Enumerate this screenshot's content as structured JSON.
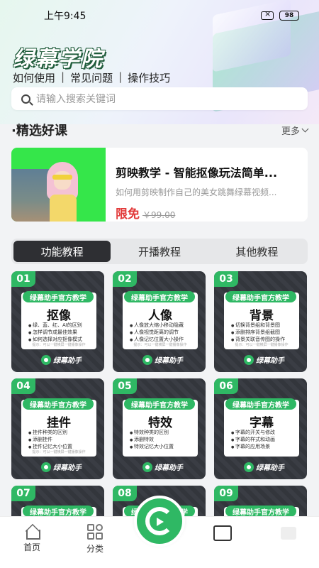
{
  "status_bar": {
    "time": "上午9:45",
    "battery": "98"
  },
  "hero": {
    "brand": "绿幕学院",
    "subnav": [
      "如何使用",
      "常见问题",
      "操作技巧"
    ],
    "subnav_separator": "|"
  },
  "search": {
    "placeholder": "请输入搜索关键词"
  },
  "featured": {
    "title": "·精选好课",
    "more_label": "更多",
    "course": {
      "title": "剪映教学 - 智能抠像玩法简单...",
      "description": "如何用剪映制作自己的美女跳舞绿幕视频...",
      "price_label": "限免",
      "original_price": "￥99.00"
    }
  },
  "tabs": [
    {
      "label": "功能教程",
      "active": true
    },
    {
      "label": "开播教程",
      "active": false
    },
    {
      "label": "其他教程",
      "active": false
    }
  ],
  "cards": [
    {
      "number": "01",
      "tag": "绿幕助手官方教学",
      "title": "抠像",
      "points": [
        "绿、蓝、红、AI的区别",
        "怎样调节成最佳效果",
        "如何选择对应抠像模式"
      ],
      "tip": "提示：可以一键横屏一键播像操作",
      "logo": "绿幕助手"
    },
    {
      "number": "02",
      "tag": "绿幕助手官方教学",
      "title": "人像",
      "points": [
        "人像放大缩小移动隐藏",
        "人像视觉距离的调节",
        "人像记忆位置大小操作"
      ],
      "tip": "提示：可以一键横屏一键播像操作",
      "logo": "绿幕助手"
    },
    {
      "number": "03",
      "tag": "绿幕助手官方教学",
      "title": "背景",
      "points": [
        "切换背景组和背景图",
        "添删排序背景组截图",
        "背景关联音传图的操作"
      ],
      "tip": "提示：可以一键横屏一键播像操作",
      "logo": "绿幕助手"
    },
    {
      "number": "04",
      "tag": "绿幕助手官方教学",
      "title": "挂件",
      "points": [
        "挂件种类的区别",
        "添删挂件",
        "挂件记忆大小位置"
      ],
      "tip": "提示：可以一键横屏一键播像操作",
      "logo": "绿幕助手"
    },
    {
      "number": "05",
      "tag": "绿幕助手官方教学",
      "title": "特效",
      "points": [
        "特效种类的区别",
        "添删特效",
        "特效记忆大小位置"
      ],
      "tip": "",
      "logo": "绿幕助手"
    },
    {
      "number": "06",
      "tag": "绿幕助手官方教学",
      "title": "字幕",
      "points": [
        "字幕的开关与修改",
        "字幕的样式和动画",
        "字幕的应用场景"
      ],
      "tip": "",
      "logo": "绿幕助手"
    },
    {
      "number": "07",
      "tag": "绿幕助手官方教学",
      "title": "",
      "points": [],
      "tip": "",
      "logo": ""
    },
    {
      "number": "08",
      "tag": "绿幕助手官方教学",
      "title": "",
      "points": [],
      "tip": "",
      "logo": ""
    },
    {
      "number": "09",
      "tag": "绿幕助手官方教学",
      "title": "",
      "points": [],
      "tip": "",
      "logo": ""
    }
  ],
  "bottom_nav": {
    "items": [
      {
        "label": "首页",
        "icon": "home-icon"
      },
      {
        "label": "分类",
        "icon": "category-icon"
      }
    ],
    "center_icon": "green-screen-logo-icon"
  },
  "colors": {
    "accent_green": "#2fb864",
    "price_red": "#e23a3a",
    "tab_active": "#2e2f33"
  }
}
